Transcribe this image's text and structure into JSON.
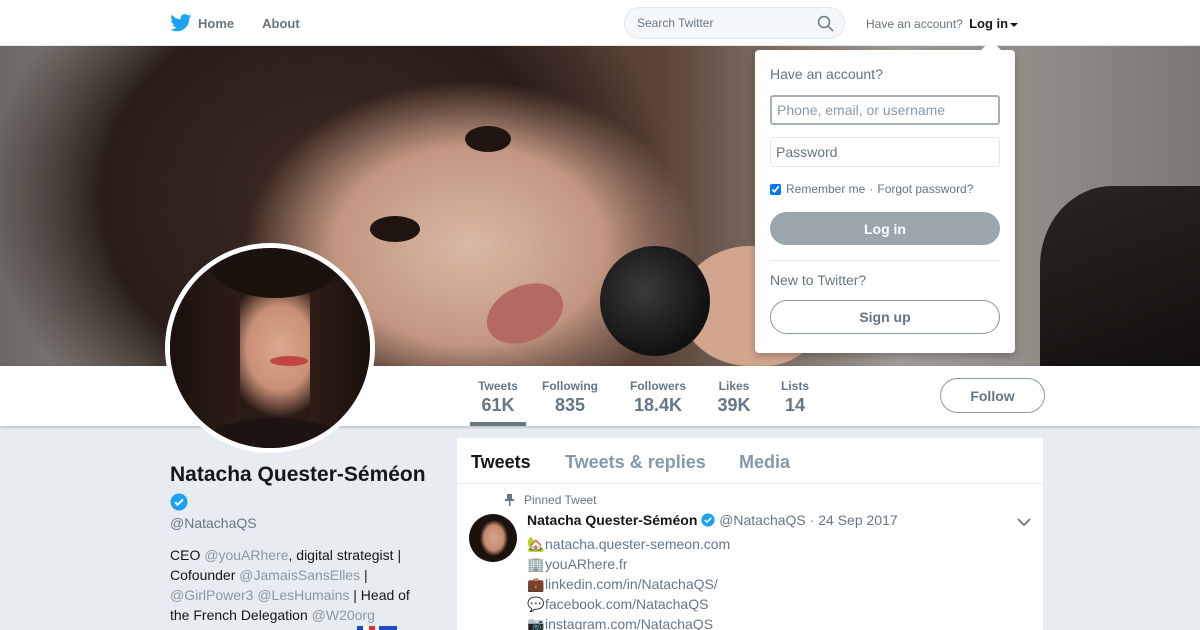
{
  "nav": {
    "home": "Home",
    "about": "About",
    "search_placeholder": "Search Twitter",
    "have_account": "Have an account?",
    "login": "Log in"
  },
  "stats": [
    {
      "label": "Tweets",
      "value": "61K"
    },
    {
      "label": "Following",
      "value": "835"
    },
    {
      "label": "Followers",
      "value": "18.4K"
    },
    {
      "label": "Likes",
      "value": "39K"
    },
    {
      "label": "Lists",
      "value": "14"
    }
  ],
  "follow_label": "Follow",
  "profile": {
    "name": "Natacha Quester-Séméon",
    "handle": "@NatachaQS",
    "bio": {
      "t1": "CEO ",
      "l1": "@youARhere",
      "t2": ", digital strategist | Cofounder ",
      "l2": "@JamaisSansElles",
      "t3": " | ",
      "l3": "@GirlPower3",
      "t4": " ",
      "l4": "@LesHumains",
      "t5": " | Head of the French Delegation ",
      "l5": "@W20org"
    }
  },
  "timeline": {
    "tabs": [
      "Tweets",
      "Tweets & replies",
      "Media"
    ],
    "pinned_label": "Pinned Tweet",
    "tweet": {
      "name": "Natacha Quester-Séméon",
      "handle": "@NatachaQS",
      "date": "24 Sep 2017",
      "lines": [
        {
          "emoji": "🏡",
          "text": "natacha.quester-semeon.com"
        },
        {
          "emoji": "🏢",
          "text": "youARhere.fr"
        },
        {
          "emoji": "💼",
          "text": "linkedin.com/in/NatachaQS/"
        },
        {
          "emoji": "💬",
          "text": "facebook.com/NatachaQS"
        },
        {
          "emoji": "📷",
          "text": "instagram.com/NatachaQS"
        }
      ]
    }
  },
  "login_dropdown": {
    "title": "Have an account?",
    "username_placeholder": "Phone, email, or username",
    "password_placeholder": "Password",
    "remember": "Remember me",
    "forgot": "Forgot password?",
    "login_button": "Log in",
    "new_to": "New to Twitter?",
    "signup_button": "Sign up"
  },
  "colors": {
    "twitter_blue": "#1da1f2",
    "muted_gray": "#657786",
    "background": "#e6ecf0"
  }
}
